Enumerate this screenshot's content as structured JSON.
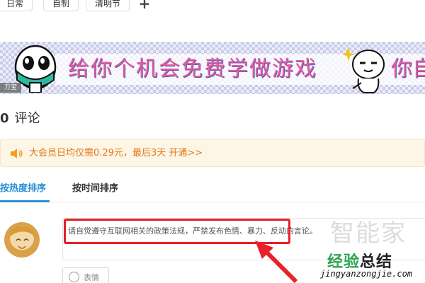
{
  "tags": {
    "items": [
      "日常",
      "自制",
      "清明节"
    ],
    "add_label": "+"
  },
  "banner": {
    "text": "给你个机会免费学做游戏",
    "text_overflow": "你自",
    "badge": "万宝",
    "colors": {
      "text": "#e55a9a",
      "shadow": "#5a5fb8"
    }
  },
  "comments": {
    "count": "0",
    "label": "评论"
  },
  "vip_notice": {
    "icon": "speaker-icon",
    "text": "大会员日均仅需0.29元，最后3天 开通>>",
    "color": "#e07b1a"
  },
  "sort": {
    "tabs": [
      {
        "label": "按热度排序",
        "active": true
      },
      {
        "label": "按时间排序",
        "active": false
      }
    ],
    "accent": "#2a8fd6"
  },
  "composer": {
    "placeholder": "请自觉遵守互联网相关的政策法规，严禁发布色情、暴力、反动的言论。",
    "emoji_label": "表情",
    "highlight_color": "#e8202a"
  },
  "watermark": {
    "big": "智能家",
    "main_prefix": "经验",
    "main_suffix": "总结",
    "url": "jingyanzongjie.com"
  }
}
